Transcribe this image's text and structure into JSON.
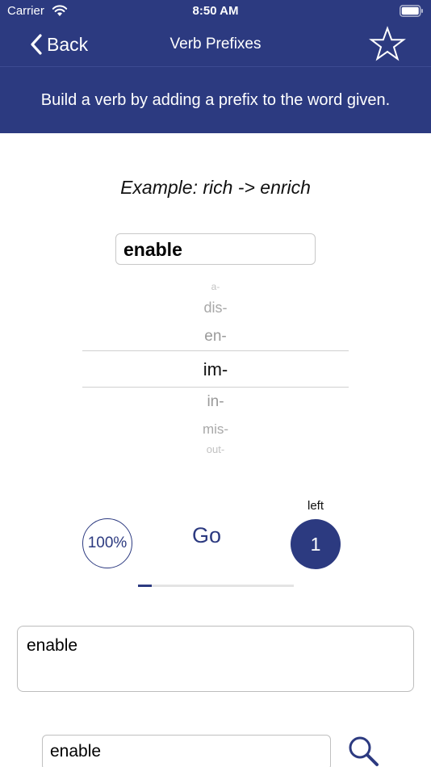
{
  "status_bar": {
    "carrier": "Carrier",
    "time": "8:50 AM",
    "wifi_icon": "wifi-icon",
    "battery_icon": "battery-icon"
  },
  "nav": {
    "back_label": "Back",
    "title": "Verb Prefixes",
    "favorite_icon": "star-icon",
    "back_icon": "chevron-left-icon"
  },
  "instruction": "Build a verb by adding a prefix to the word given.",
  "example": "Example: rich -> enrich",
  "word": "enable",
  "picker": {
    "items": [
      "a-",
      "dis-",
      "en-",
      "im-",
      "in-",
      "mis-",
      "out-"
    ],
    "selected": "im-"
  },
  "controls": {
    "percent": "100%",
    "go_label": "Go",
    "left_label": "left",
    "remaining": "1",
    "progress": 0.09
  },
  "answer": "enable",
  "search": {
    "value": "enable",
    "icon": "search-icon"
  },
  "colors": {
    "brand": "#2c3a80",
    "background": "#ffffff"
  }
}
